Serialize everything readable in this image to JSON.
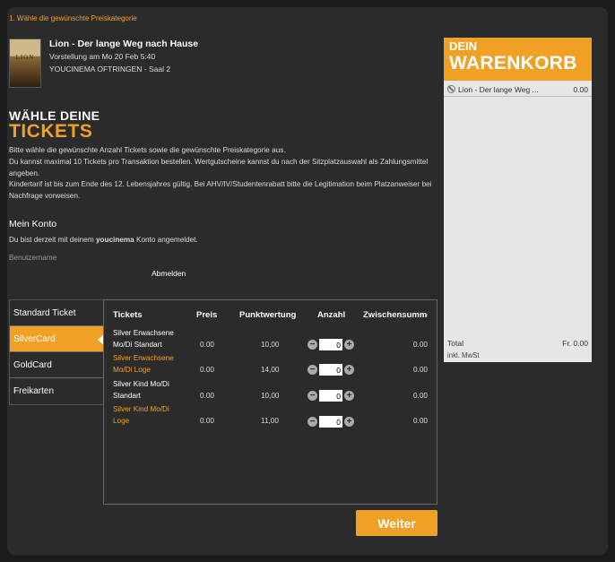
{
  "step": "1. Wähle die gewünschte Preiskategorie",
  "poster_text": "LION",
  "movie": {
    "title": "Lion - Der lange Weg nach Hause",
    "showtime": "Vorstellung am Mo 20 Feb 5:40",
    "location": "YOUCINEMA OFTRINGEN - Saal 2"
  },
  "heading": {
    "line1": "WÄHLE DEINE",
    "line2": "TICKETS"
  },
  "intro": {
    "p1": "Bitte wähle die gewünschte Anzahl Tickets sowie die gewünschte Preiskategorie aus.",
    "p2": "Du kannst maximal 10 Tickets pro Transaktion bestellen. Wertgutscheine kannst du nach der Sitzplatzauswahl als Zahlungsmittel angeben.",
    "p3": "Kindertarif ist bis zum Ende des 12. Lebensjahres gültig. Bei AHV/IV/Studentenrabatt bitte die Legitimation beim Platzanweiser bei Nachfrage vorweisen."
  },
  "konto": {
    "title": "Mein Konto",
    "text_before": "Du bist derzeit mit deinem ",
    "brand": "youcinema",
    "text_after": " Konto angemeldet.",
    "username_label": "Benutzername",
    "logout": "Abmelden"
  },
  "categories": [
    "Standard Ticket",
    "SilverCard",
    "GoldCard",
    "Freikarten"
  ],
  "active_category": "SilverCard",
  "table": {
    "headers": [
      "Tickets",
      "Preis",
      "Punktwertung",
      "Anzahl",
      "Zwischensumme"
    ],
    "rows": [
      {
        "name": "Silver Erwachsene Mo/Di Standart",
        "price": "0.00",
        "points": "10,00",
        "qty": "0",
        "subtotal": "0.00"
      },
      {
        "name": "Silver Erwachsene Mo/Di Loge",
        "price": "0.00",
        "points": "14,00",
        "qty": "0",
        "subtotal": "0.00"
      },
      {
        "name": "Silver Kind Mo/Di Standart",
        "price": "0.00",
        "points": "10,00",
        "qty": "0",
        "subtotal": "0.00"
      },
      {
        "name": "Silver Kind Mo/Di Loge",
        "price": "0.00",
        "points": "11,00",
        "qty": "0",
        "subtotal": "0.00"
      }
    ]
  },
  "weiter": "Weiter",
  "cart": {
    "title_small": "DEIN",
    "title_big": "WARENKORB",
    "item_name": "Lion - Der lange Weg ...",
    "item_price": "0.00",
    "total_label": "Total",
    "total_value": "Fr. 0.00",
    "mwst": "inkl. MwSt"
  },
  "colors": {
    "accent": "#f0a125",
    "background": "#2b2b2b",
    "cart_bg": "#e6e6e6"
  }
}
